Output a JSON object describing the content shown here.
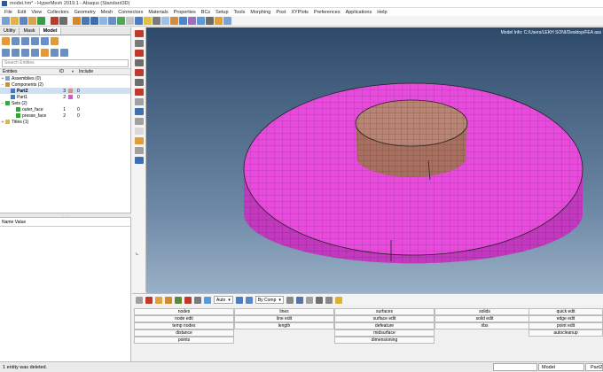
{
  "window": {
    "title": "model.hm* - HyperMesh 2019.1 - Abaqus (Standard3D)"
  },
  "menu": [
    "File",
    "Edit",
    "View",
    "Collectors",
    "Geometry",
    "Mesh",
    "Connectors",
    "Materials",
    "Properties",
    "BCs",
    "Setup",
    "Tools",
    "Morphing",
    "Post",
    "XYPlots",
    "Preferences",
    "Applications",
    "Help"
  ],
  "left_tabs": [
    "Utility",
    "Mask",
    "Model"
  ],
  "search_placeholder": "Search Entities",
  "entity_header": {
    "entities": "Entities",
    "id": "ID",
    "include": "Include"
  },
  "tree": {
    "assemblies": "Assemblies (0)",
    "components": "Components (2)",
    "comp_part2": {
      "name": "Part2",
      "id": "3",
      "color": "#e08c8c",
      "include": "0"
    },
    "comp_part1": {
      "name": "Part1",
      "id": "2",
      "color": "#e64bdc",
      "include": "0"
    },
    "sets": "Sets (2)",
    "set_outer": {
      "name": "outer_face",
      "id": "1",
      "include": "0"
    },
    "set_presse": {
      "name": "presse_face",
      "id": "2",
      "include": "0"
    },
    "titles": "Titles (1)"
  },
  "name_value_header": "Name Value",
  "viewport_info": "Model Info: C:/Users/LEKH SONI/Desktop/FEA ass",
  "bottom_toolbar": {
    "auto": "Auto",
    "by_comp": "By Comp"
  },
  "panel": {
    "col1": [
      "nodes",
      "node edit",
      "temp nodes",
      "distance",
      "points"
    ],
    "col2": [
      "lines",
      "line edit",
      "length"
    ],
    "col3": [
      "surfaces",
      "surface edit",
      "defeature",
      "midsurface",
      "dimensioning"
    ],
    "col4": [
      "solids",
      "solid edit",
      "ribs"
    ],
    "col5": [
      "quick edit",
      "edge edit",
      "point edit",
      "autocleanup"
    ]
  },
  "status": {
    "message": "1 entity was deleted.",
    "model": "Model",
    "component": "Part2"
  },
  "colors": {
    "magenta": "#e64bdc",
    "brown": "#b88474",
    "bg_top": "#2e4a6a",
    "bg_bottom": "#9ab0c6"
  }
}
